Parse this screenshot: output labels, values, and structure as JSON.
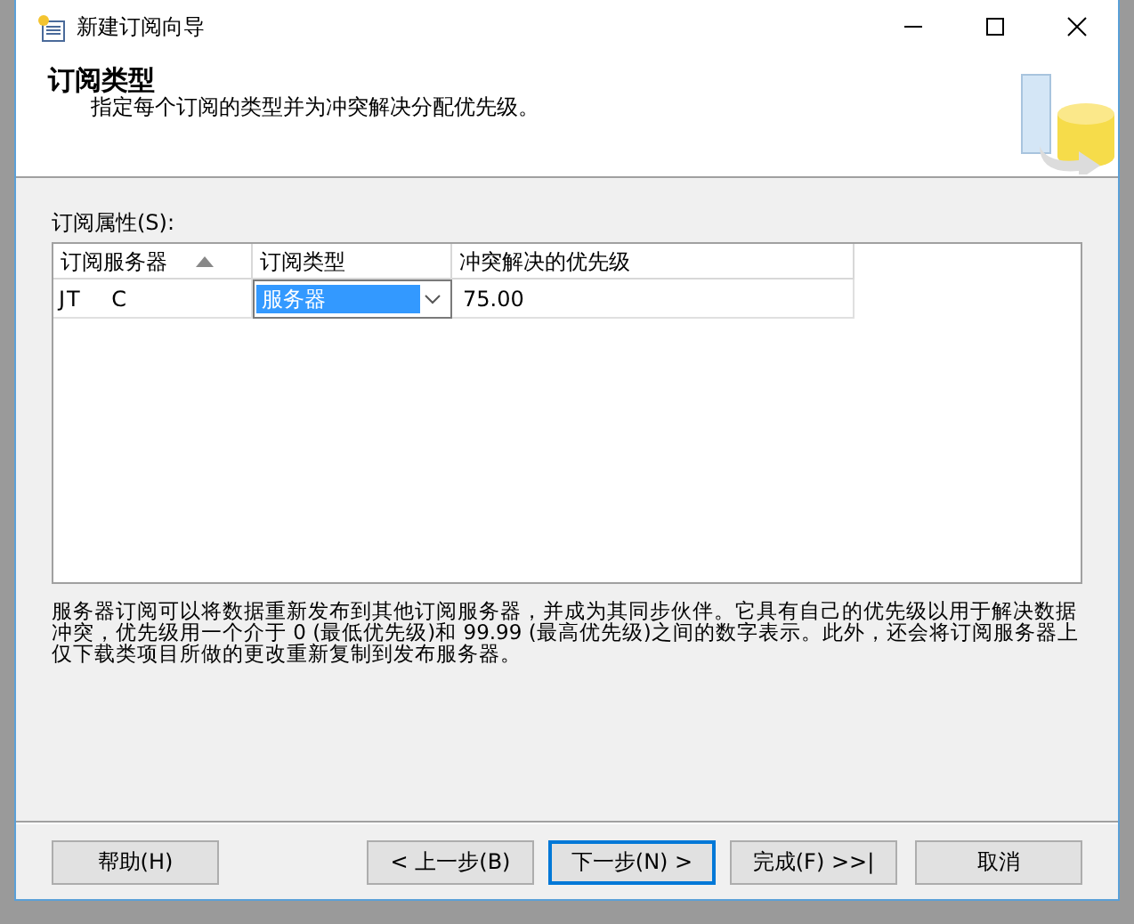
{
  "window": {
    "title": "新建订阅向导"
  },
  "header": {
    "title": "订阅类型",
    "subtitle": "指定每个订阅的类型并为冲突解决分配优先级。"
  },
  "grid": {
    "label": "订阅属性(S):",
    "columns": [
      {
        "label": "订阅服务器",
        "sorted": true
      },
      {
        "label": "订阅类型",
        "sorted": false
      },
      {
        "label": "冲突解决的优先级",
        "sorted": false
      }
    ],
    "rows": [
      {
        "server": "JT C",
        "type": "服务器",
        "priority": "75.00"
      }
    ]
  },
  "description": "服务器订阅可以将数据重新发布到其他订阅服务器，并成为其同步伙伴。它具有自己的优先级以用于解决数据冲突，优先级用一个介于 0 (最低优先级)和 99.99 (最高优先级)之间的数字表示。此外，还会将订阅服务器上仅下载类项目所做的更改重新复制到发布服务器。",
  "buttons": [
    {
      "label": "帮助(H)",
      "focused": false
    },
    {
      "label": "< 上一步(B)",
      "focused": false
    },
    {
      "label": "下一步(N) >",
      "focused": true
    },
    {
      "label": "完成(F) >>|",
      "focused": false
    },
    {
      "label": "取消",
      "focused": false
    }
  ]
}
